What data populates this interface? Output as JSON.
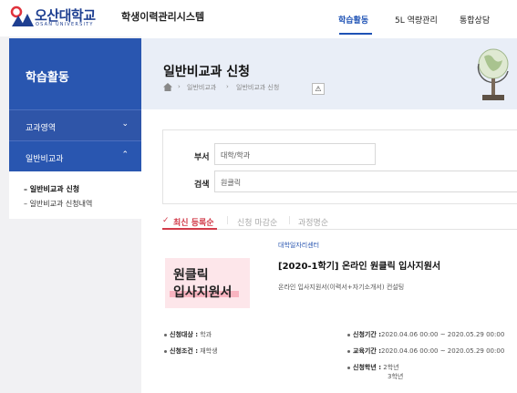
{
  "header": {
    "logo_text": "오산대학교",
    "logo_sub": "OSAN UNIVERSITY",
    "system_title": "학생이력관리시스템",
    "nav": [
      "학습활동",
      "5L 역량관리",
      "통합상담"
    ],
    "active_nav": "학습활동"
  },
  "sidebar": {
    "title": "학습활동",
    "items": [
      {
        "label": "교과영역",
        "chevron": "⌄"
      },
      {
        "label": "일반비교과",
        "chevron": "⌃"
      }
    ],
    "subitems": [
      "일반비교과 신청",
      "일반비교과 신청내역"
    ]
  },
  "main": {
    "title": "일반비교과 신청",
    "breadcrumb": [
      "일반비교과",
      "일반비교과 신청"
    ],
    "warn_symbol": "⚠"
  },
  "search": {
    "dept_label": "부서",
    "dept_value": "대학/학과",
    "keyword_label": "검색",
    "keyword_value": "원클릭"
  },
  "tabs": [
    "최신 등록순",
    "신청 마감순",
    "과정명순"
  ],
  "program": {
    "thumb_line1": "원클릭",
    "thumb_line2": "입사지원서",
    "org": "대학일자리센터",
    "title": "[2020-1학기] 온라인 원클릭 입사지원서",
    "desc": "온라인 입사지원서(이력서+자기소개서) 컨설팅",
    "target_label": "신청대상 :",
    "target_value": "학과",
    "condition_label": "신청조건 :",
    "condition_value": "재학생",
    "apply_period_label": "신청기간 :",
    "apply_period_value": "2020.04.06 00:00 ~ 2020.05.29 00:00",
    "edu_period_label": "교육기간 :",
    "edu_period_value": "2020.04.06 00:00 ~ 2020.05.29 00:00",
    "grade_label": "신청학년 :",
    "grade_values": [
      "2학년",
      "3학년"
    ]
  },
  "colors": {
    "brand_blue": "#2956b0",
    "accent_red": "#d23b4a",
    "header_bg": "#e9eef7"
  }
}
